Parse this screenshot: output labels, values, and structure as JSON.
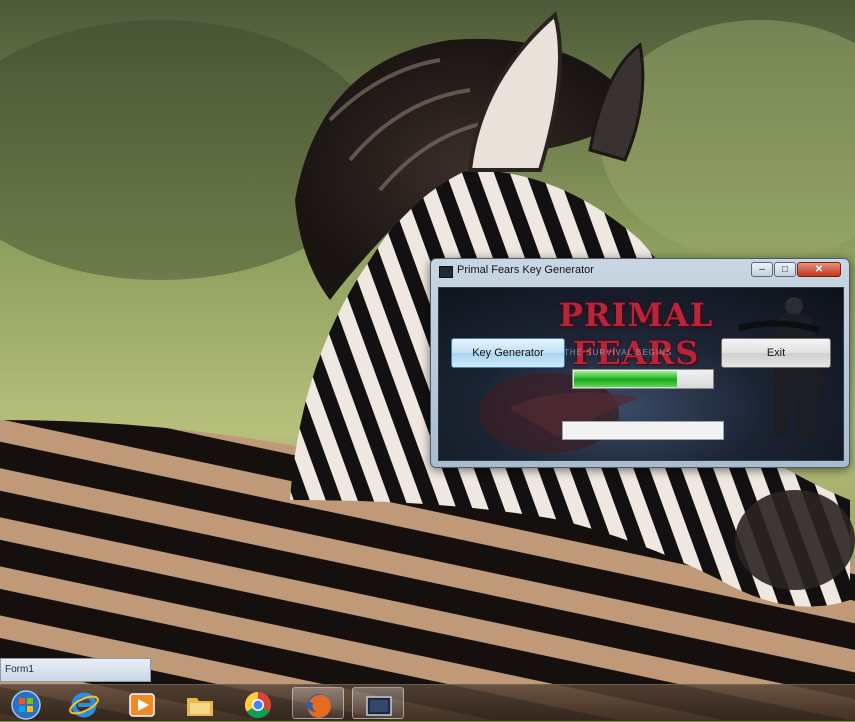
{
  "window": {
    "title": "Primal Fears Key Generator",
    "close_glyph": "✕",
    "minimize_glyph": "–",
    "maximize_glyph": "□"
  },
  "keygen": {
    "logo_text": "PRIMAL FEARS",
    "subtitle": "THE SURVIVAL BEGINS",
    "generate_label": "Key Generator",
    "exit_label": "Exit",
    "progress_fraction": 0.75,
    "key_value": ""
  },
  "taskbar": {
    "thumbnail_label": "Form1",
    "items": [
      {
        "icon": "start-orb-icon"
      },
      {
        "icon": "internet-explorer-icon"
      },
      {
        "icon": "media-player-icon"
      },
      {
        "icon": "file-explorer-icon"
      },
      {
        "icon": "chrome-icon"
      },
      {
        "icon": "firefox-icon",
        "active": true
      },
      {
        "icon": "keygen-app-icon",
        "active": true
      }
    ]
  },
  "colors": {
    "logo_red": "#b8243a",
    "progress_green": "#21b41c",
    "taskbar": "#4a3a2c"
  }
}
